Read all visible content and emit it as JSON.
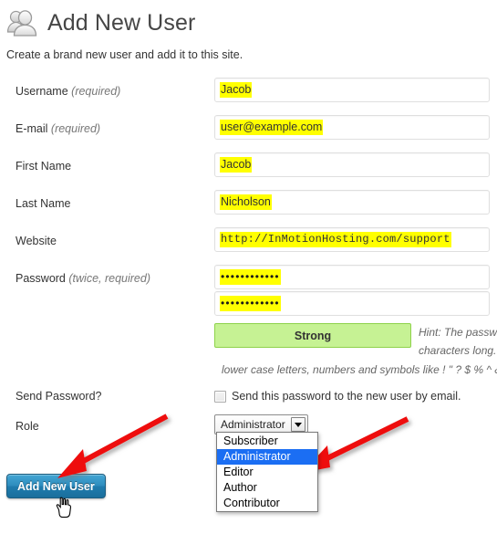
{
  "header": {
    "icon": "users-icon",
    "title": "Add New User",
    "subtitle": "Create a brand new user and add it to this site."
  },
  "form": {
    "fields": [
      {
        "name": "username",
        "label": "Username",
        "qualifier": "(required)",
        "value": "Jacob",
        "type": "text",
        "highlighted": true
      },
      {
        "name": "email",
        "label": "E-mail",
        "qualifier": "(required)",
        "value": "user@example.com",
        "type": "email",
        "highlighted": true
      },
      {
        "name": "first-name",
        "label": "First Name",
        "qualifier": "",
        "value": "Jacob",
        "type": "text",
        "highlighted": true
      },
      {
        "name": "last-name",
        "label": "Last Name",
        "qualifier": "",
        "value": "Nicholson",
        "type": "text",
        "highlighted": true
      },
      {
        "name": "website",
        "label": "Website",
        "qualifier": "",
        "value": "http://InMotionHosting.com/support",
        "type": "url",
        "highlighted": true
      }
    ],
    "password": {
      "label": "Password",
      "qualifier": "(twice, required)",
      "value_masked": "••••••••••••",
      "confirm_masked": "••••••••••••",
      "strength_label": "Strong",
      "strength_color": "#c6f294",
      "strength_border": "#8ed24b",
      "hint_line_1": "Hint: The passwo",
      "hint_line_2": "characters long.",
      "hint_line_3": "lower case letters, numbers and symbols like ! \" ? $ % ^ &"
    },
    "send_password": {
      "label": "Send Password?",
      "checkbox_label": "Send this password to the new user by email.",
      "checked": false
    },
    "role": {
      "label": "Role",
      "selected": "Administrator",
      "options": [
        "Subscriber",
        "Administrator",
        "Editor",
        "Author",
        "Contributor"
      ],
      "open": true,
      "highlight_color": "#1b6ef3"
    },
    "submit_label": "Add New User"
  },
  "annotations": {
    "arrow_color": "#ee1111",
    "arrow_left_target": "add-new-user-button",
    "arrow_right_target": "role-option-administrator",
    "cursor": "hand-pointer-cursor"
  }
}
